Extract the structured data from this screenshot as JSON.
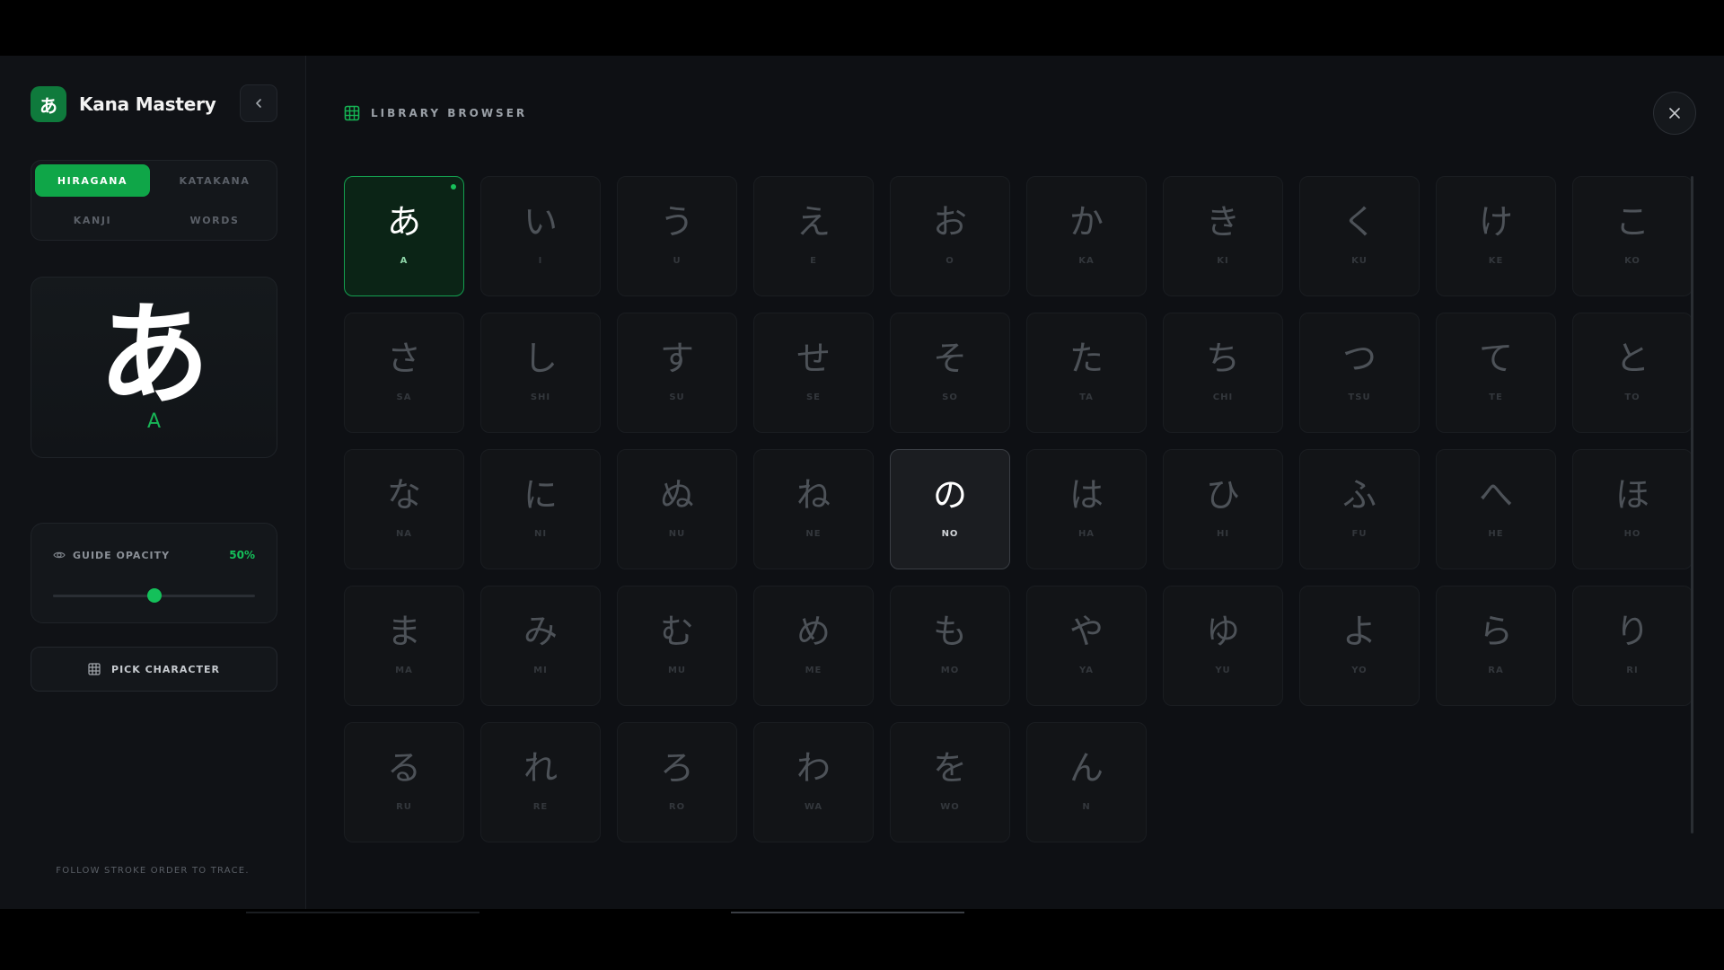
{
  "app": {
    "logo_char": "あ",
    "title": "Kana Mastery"
  },
  "tabs": [
    {
      "label": "HIRAGANA",
      "active": true
    },
    {
      "label": "KATAKANA",
      "active": false
    },
    {
      "label": "KANJI",
      "active": false
    },
    {
      "label": "WORDS",
      "active": false
    }
  ],
  "preview": {
    "char": "あ",
    "romaji": "A"
  },
  "guide_opacity": {
    "label": "GUIDE OPACITY",
    "value_text": "50%",
    "value": 0.5
  },
  "pick_button": {
    "label": "PICK CHARACTER"
  },
  "footer": {
    "hint": "FOLLOW STROKE ORDER TO TRACE."
  },
  "library": {
    "title": "LIBRARY BROWSER",
    "characters": [
      {
        "kana": "あ",
        "romaji": "A",
        "state": "selected"
      },
      {
        "kana": "い",
        "romaji": "I"
      },
      {
        "kana": "う",
        "romaji": "U"
      },
      {
        "kana": "え",
        "romaji": "E"
      },
      {
        "kana": "お",
        "romaji": "O"
      },
      {
        "kana": "か",
        "romaji": "KA"
      },
      {
        "kana": "き",
        "romaji": "KI"
      },
      {
        "kana": "く",
        "romaji": "KU"
      },
      {
        "kana": "け",
        "romaji": "KE"
      },
      {
        "kana": "こ",
        "romaji": "KO"
      },
      {
        "kana": "さ",
        "romaji": "SA"
      },
      {
        "kana": "し",
        "romaji": "SHI"
      },
      {
        "kana": "す",
        "romaji": "SU"
      },
      {
        "kana": "せ",
        "romaji": "SE"
      },
      {
        "kana": "そ",
        "romaji": "SO"
      },
      {
        "kana": "た",
        "romaji": "TA"
      },
      {
        "kana": "ち",
        "romaji": "CHI"
      },
      {
        "kana": "つ",
        "romaji": "TSU"
      },
      {
        "kana": "て",
        "romaji": "TE"
      },
      {
        "kana": "と",
        "romaji": "TO"
      },
      {
        "kana": "な",
        "romaji": "NA"
      },
      {
        "kana": "に",
        "romaji": "NI"
      },
      {
        "kana": "ぬ",
        "romaji": "NU"
      },
      {
        "kana": "ね",
        "romaji": "NE"
      },
      {
        "kana": "の",
        "romaji": "NO",
        "state": "hover"
      },
      {
        "kana": "は",
        "romaji": "HA"
      },
      {
        "kana": "ひ",
        "romaji": "HI"
      },
      {
        "kana": "ふ",
        "romaji": "FU"
      },
      {
        "kana": "へ",
        "romaji": "HE"
      },
      {
        "kana": "ほ",
        "romaji": "HO"
      },
      {
        "kana": "ま",
        "romaji": "MA"
      },
      {
        "kana": "み",
        "romaji": "MI"
      },
      {
        "kana": "む",
        "romaji": "MU"
      },
      {
        "kana": "め",
        "romaji": "ME"
      },
      {
        "kana": "も",
        "romaji": "MO"
      },
      {
        "kana": "や",
        "romaji": "YA"
      },
      {
        "kana": "ゆ",
        "romaji": "YU"
      },
      {
        "kana": "よ",
        "romaji": "YO"
      },
      {
        "kana": "ら",
        "romaji": "RA"
      },
      {
        "kana": "り",
        "romaji": "RI"
      },
      {
        "kana": "る",
        "romaji": "RU"
      },
      {
        "kana": "れ",
        "romaji": "RE"
      },
      {
        "kana": "ろ",
        "romaji": "RO"
      },
      {
        "kana": "わ",
        "romaji": "WA"
      },
      {
        "kana": "を",
        "romaji": "WO"
      },
      {
        "kana": "ん",
        "romaji": "N"
      }
    ]
  },
  "icons": {
    "collapse": "chevron-left-icon",
    "library": "grid-icon",
    "close": "close-icon",
    "opacity": "eye-icon",
    "pick": "grid-icon"
  },
  "colors": {
    "accent": "#0fa648",
    "accent_bright": "#14c05a",
    "background": "#0e1014"
  }
}
